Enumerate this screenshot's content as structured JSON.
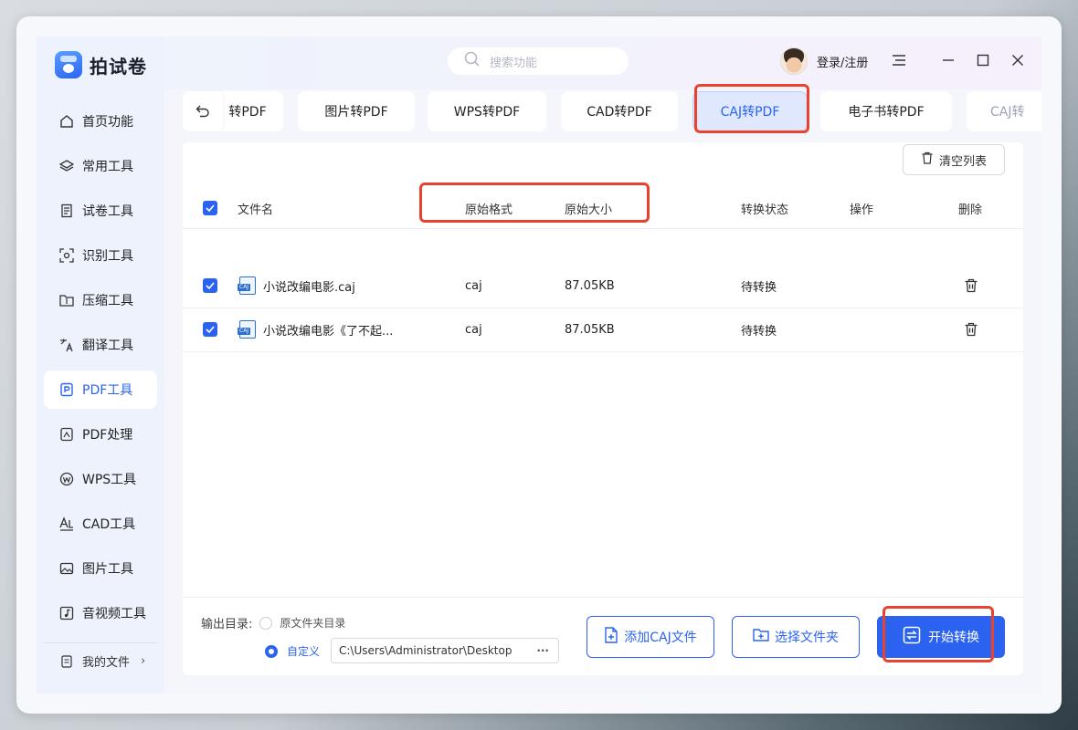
{
  "app": {
    "name": "拍试卷"
  },
  "sidebar": {
    "items": [
      {
        "label": "首页功能",
        "icon": "home-icon"
      },
      {
        "label": "常用工具",
        "icon": "layers-icon"
      },
      {
        "label": "试卷工具",
        "icon": "paper-icon"
      },
      {
        "label": "识别工具",
        "icon": "scan-icon"
      },
      {
        "label": "压缩工具",
        "icon": "compress-icon"
      },
      {
        "label": "翻译工具",
        "icon": "translate-icon"
      },
      {
        "label": "PDF工具",
        "icon": "pdf-icon",
        "active": true
      },
      {
        "label": "PDF处理",
        "icon": "pdf-edit-icon"
      },
      {
        "label": "WPS工具",
        "icon": "wps-icon"
      },
      {
        "label": "CAD工具",
        "icon": "cad-icon"
      },
      {
        "label": "图片工具",
        "icon": "image-icon"
      },
      {
        "label": "音视频工具",
        "icon": "music-icon"
      }
    ],
    "my_files": "我的文件"
  },
  "header": {
    "search_placeholder": "搜索功能",
    "login_label": "登录/注册"
  },
  "tabs": [
    {
      "label": "转PDF"
    },
    {
      "label": "图片转PDF"
    },
    {
      "label": "WPS转PDF"
    },
    {
      "label": "CAD转PDF"
    },
    {
      "label": "CAJ转PDF",
      "active": true
    },
    {
      "label": "电子书转PDF"
    },
    {
      "label": "CAJ转"
    }
  ],
  "table": {
    "clear_label": "清空列表",
    "columns": {
      "name": "文件名",
      "format": "原始格式",
      "size": "原始大小",
      "status": "转换状态",
      "action": "操作",
      "delete": "删除"
    },
    "rows": [
      {
        "name": "小说改编电影.caj",
        "format": "caj",
        "size": "87.05KB",
        "status": "待转换"
      },
      {
        "name": "小说改编电影《了不起...",
        "format": "caj",
        "size": "87.05KB",
        "status": "待转换"
      }
    ]
  },
  "output": {
    "label": "输出目录:",
    "option_original": "原文件夹目录",
    "option_custom": "自定义",
    "path": "C:\\Users\\Administrator\\Desktop",
    "more": "···"
  },
  "buttons": {
    "add_file": "添加CAJ文件",
    "choose_folder": "选择文件夹",
    "start": "开始转换"
  },
  "file_badge": "CAJ",
  "colors": {
    "accent": "#2b63f0",
    "highlight": "#e8432e"
  }
}
